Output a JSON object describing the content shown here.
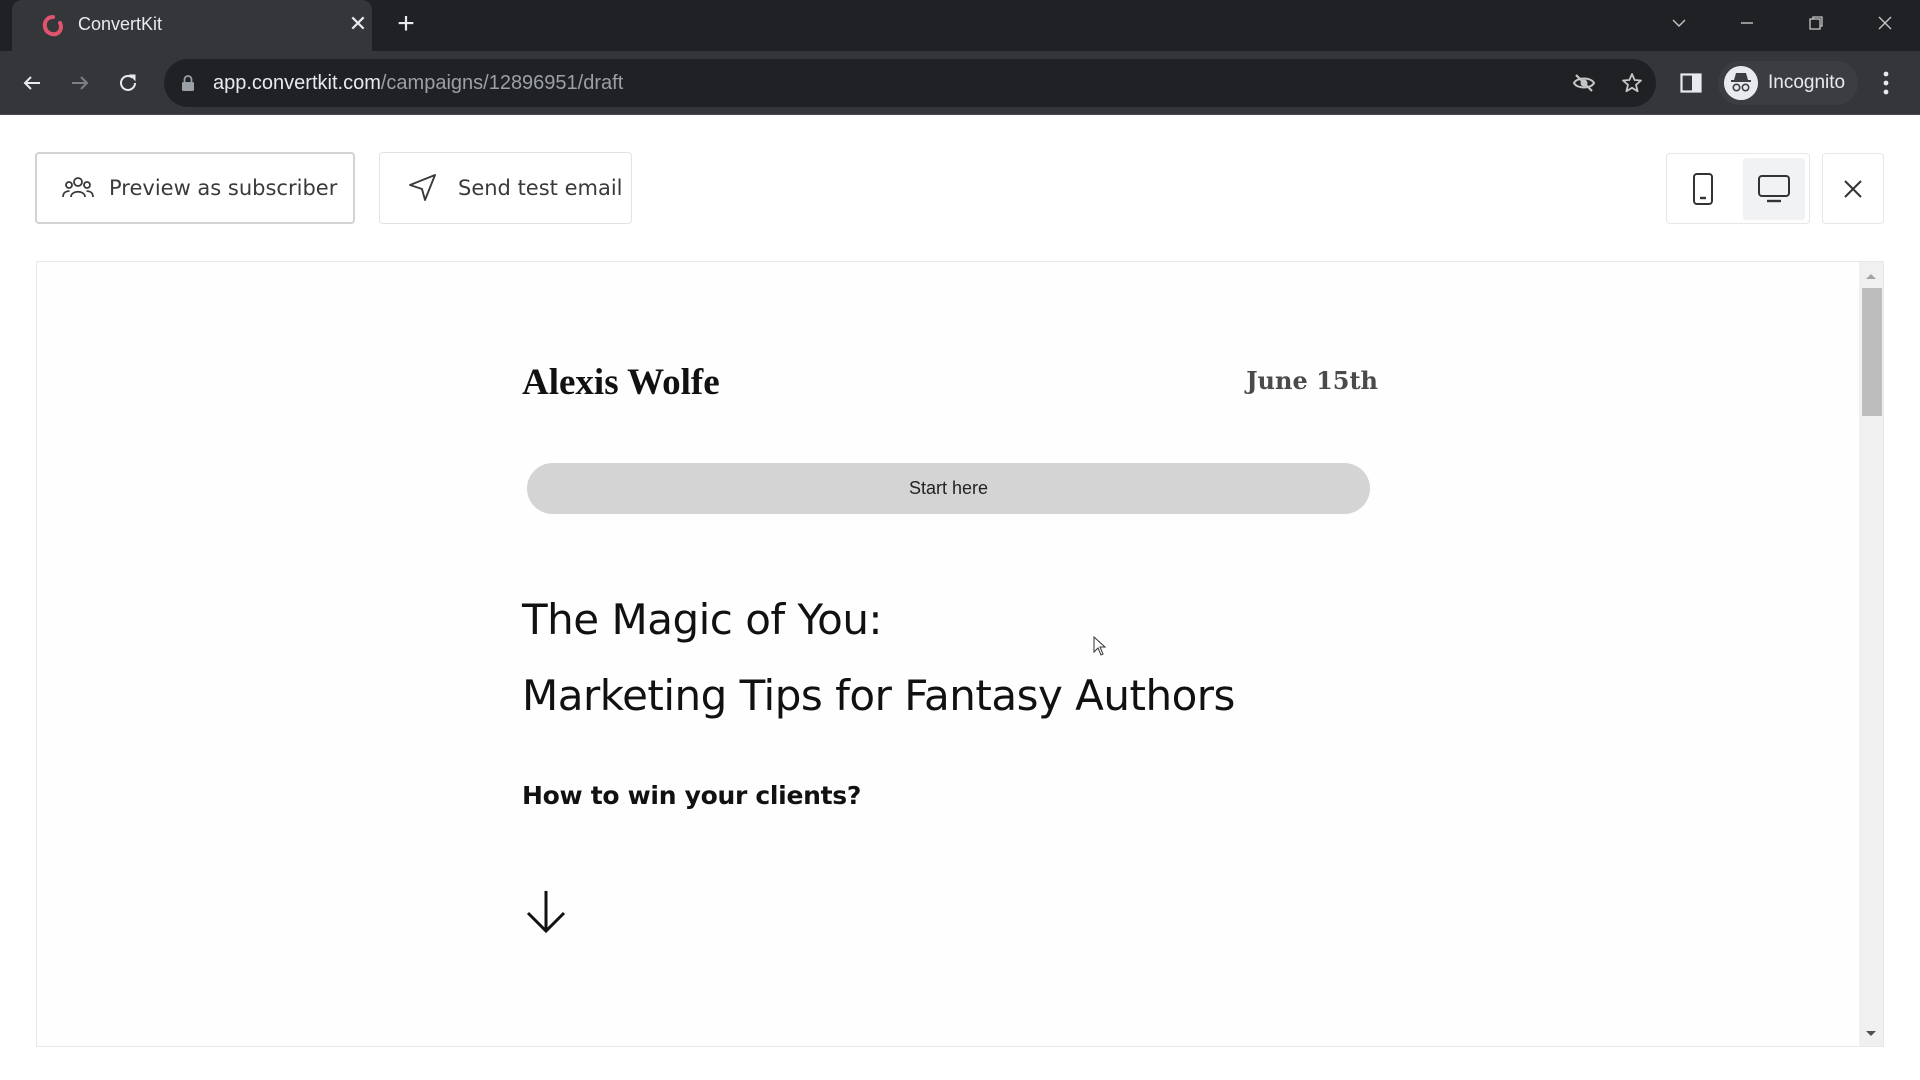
{
  "browser": {
    "tab_title": "ConvertKit",
    "favicon": "convertkit-logo-icon",
    "url_host": "app.convertkit.com",
    "url_path": "/campaigns/12896951/draft",
    "profile_label": "Incognito",
    "brand_color": "#e0546d"
  },
  "header": {
    "preview_label": "Preview as subscriber",
    "send_test_label": "Send test email",
    "device_modes": [
      "mobile",
      "desktop"
    ],
    "active_device": "desktop"
  },
  "email": {
    "sender_name": "Alexis Wolfe",
    "date": "June 15th",
    "start_button_label": "Start here",
    "headline_line1": "The Magic of You:",
    "headline_line2": "Marketing Tips for Fantasy Authors",
    "subheading": "How to win your clients?",
    "arrow_icon": "arrow-down-icon"
  },
  "preview_scroll": {
    "position_fraction": 0.0
  }
}
